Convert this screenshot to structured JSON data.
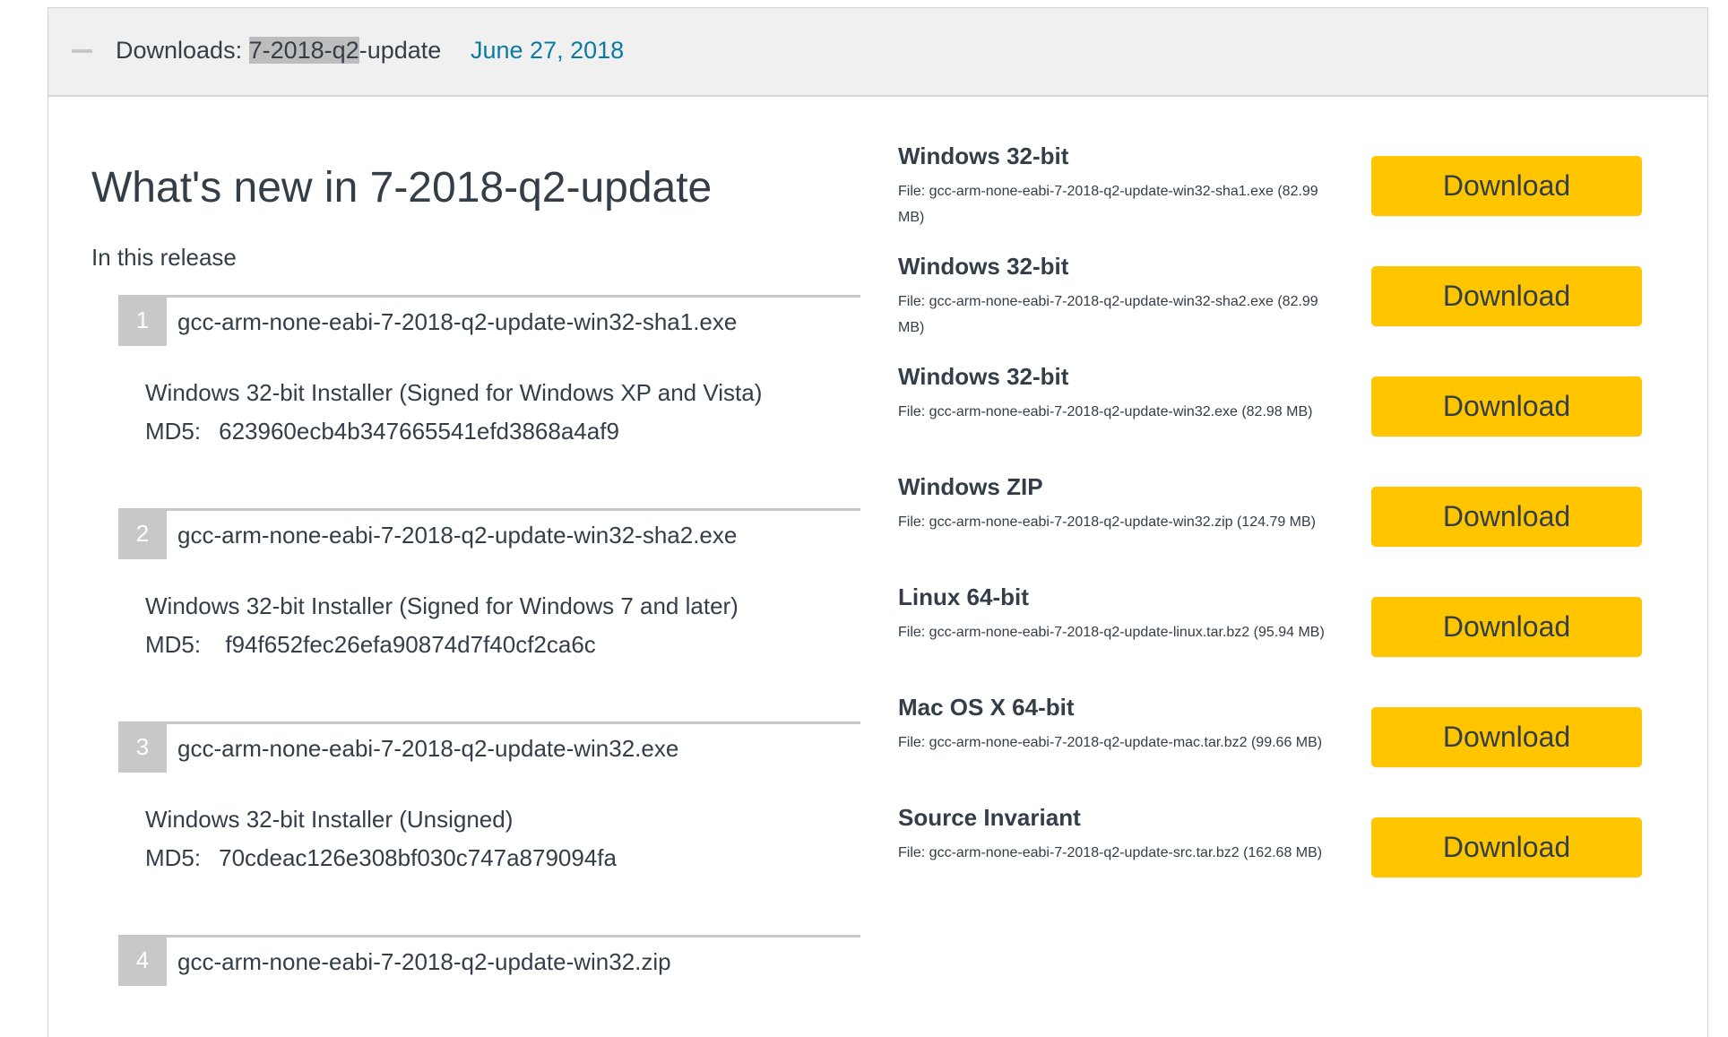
{
  "header": {
    "title_prefix": "Downloads: ",
    "title_highlight": "7-2018-q2",
    "title_suffix": "-update",
    "date": "June 27, 2018"
  },
  "main": {
    "heading": "What's new in 7-2018-q2-update",
    "subheading": "In this release"
  },
  "release_items": [
    {
      "number": "1",
      "file": "gcc-arm-none-eabi-7-2018-q2-update-win32-sha1.exe",
      "description": "Windows 32-bit Installer (Signed for Windows XP and Vista)",
      "md5_label": "MD5:",
      "md5": "623960ecb4b347665541efd3868a4af9"
    },
    {
      "number": "2",
      "file": "gcc-arm-none-eabi-7-2018-q2-update-win32-sha2.exe",
      "description": "Windows 32-bit Installer (Signed for Windows 7 and later)",
      "md5_label": "MD5:",
      "md5": " f94f652fec26efa90874d7f40cf2ca6c"
    },
    {
      "number": "3",
      "file": "gcc-arm-none-eabi-7-2018-q2-update-win32.exe",
      "description": "Windows 32-bit Installer (Unsigned)",
      "md5_label": "MD5:",
      "md5": "70cdeac126e308bf030c747a879094fa"
    },
    {
      "number": "4",
      "file": "gcc-arm-none-eabi-7-2018-q2-update-win32.zip"
    }
  ],
  "downloads": [
    {
      "title": "Windows 32-bit",
      "file": "File: gcc-arm-none-eabi-7-2018-q2-update-win32-sha1.exe (82.99 MB)",
      "button": "Download"
    },
    {
      "title": "Windows 32-bit",
      "file": "File: gcc-arm-none-eabi-7-2018-q2-update-win32-sha2.exe (82.99 MB)",
      "button": "Download"
    },
    {
      "title": "Windows 32-bit",
      "file": "File: gcc-arm-none-eabi-7-2018-q2-update-win32.exe (82.98 MB)",
      "button": "Download"
    },
    {
      "title": "Windows ZIP",
      "file": "File: gcc-arm-none-eabi-7-2018-q2-update-win32.zip (124.79 MB)",
      "button": "Download"
    },
    {
      "title": "Linux 64-bit",
      "file": "File: gcc-arm-none-eabi-7-2018-q2-update-linux.tar.bz2 (95.94 MB)",
      "button": "Download"
    },
    {
      "title": "Mac OS X 64-bit",
      "file": "File: gcc-arm-none-eabi-7-2018-q2-update-mac.tar.bz2 (99.66 MB)",
      "button": "Download"
    },
    {
      "title": "Source Invariant",
      "file": "File: gcc-arm-none-eabi-7-2018-q2-update-src.tar.bz2 (162.68 MB)",
      "button": "Download"
    }
  ],
  "colors": {
    "accent_button": "#ffc600",
    "link": "#0b7aa0",
    "header_bg": "#f0f0f0",
    "number_badge": "#c8c8c8",
    "text": "#333e48"
  },
  "icons": {
    "collapse": "minus-icon"
  }
}
